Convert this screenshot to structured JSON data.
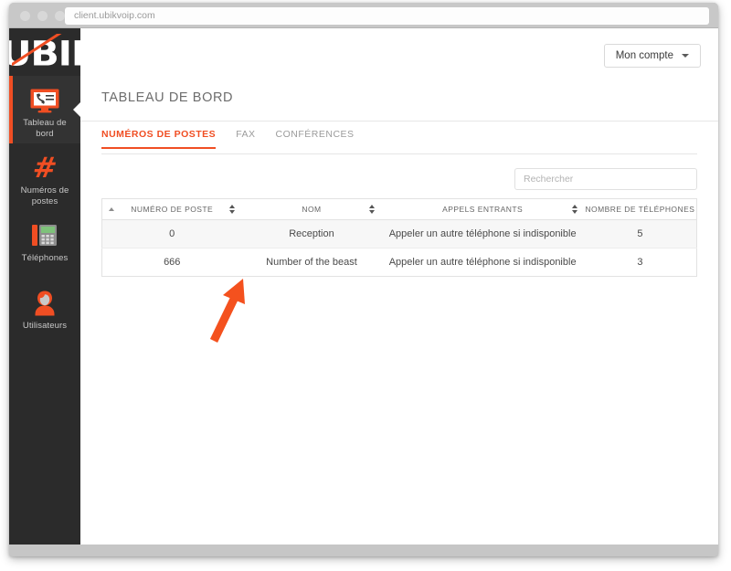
{
  "browser": {
    "url": "client.ubikvoip.com",
    "traffic_lights": [
      "close-button",
      "minimize-button",
      "maximize-button"
    ]
  },
  "brand": {
    "logo_text": "UBIK",
    "accent_color": "#f04e23",
    "sidebar_color": "#2b2b2b"
  },
  "sidebar": {
    "items": [
      {
        "label": "Tableau de bord",
        "icon": "dashboard-monitor-icon",
        "active": true
      },
      {
        "label": "Numéros de postes",
        "icon": "hash-icon",
        "active": false
      },
      {
        "label": "Téléphones",
        "icon": "desk-phone-icon",
        "active": false
      },
      {
        "label": "Utilisateurs",
        "icon": "user-avatar-icon",
        "active": false
      }
    ]
  },
  "header": {
    "account_label": "Mon compte",
    "account_caret": "chevron-down-icon"
  },
  "main": {
    "page_title": "TABLEAU DE BORD",
    "tabs": [
      {
        "label": "NUMÉROS DE POSTES",
        "active": true
      },
      {
        "label": "FAX",
        "active": false
      },
      {
        "label": "CONFÉRENCES",
        "active": false
      }
    ],
    "search": {
      "placeholder": "Rechercher",
      "value": ""
    },
    "table": {
      "columns": [
        {
          "label": "NUMÉRO DE POSTE",
          "sortable": true,
          "sorted": true
        },
        {
          "label": "NOM",
          "sortable": true,
          "sorted": false
        },
        {
          "label": "APPELS ENTRANTS",
          "sortable": true,
          "sorted": false
        },
        {
          "label": "NOMBRE DE TÉLÉPHONES",
          "sortable": false,
          "sorted": false
        }
      ],
      "rows": [
        {
          "numero": "0",
          "nom": "Reception",
          "appels": "Appeler un autre téléphone si indisponible",
          "telephones": "5"
        },
        {
          "numero": "666",
          "nom": "Number of the beast",
          "appels": "Appeler un autre téléphone si indisponible",
          "telephones": "3"
        }
      ]
    }
  },
  "annotation": {
    "arrow_color": "#f4511e",
    "points_to": "666"
  }
}
